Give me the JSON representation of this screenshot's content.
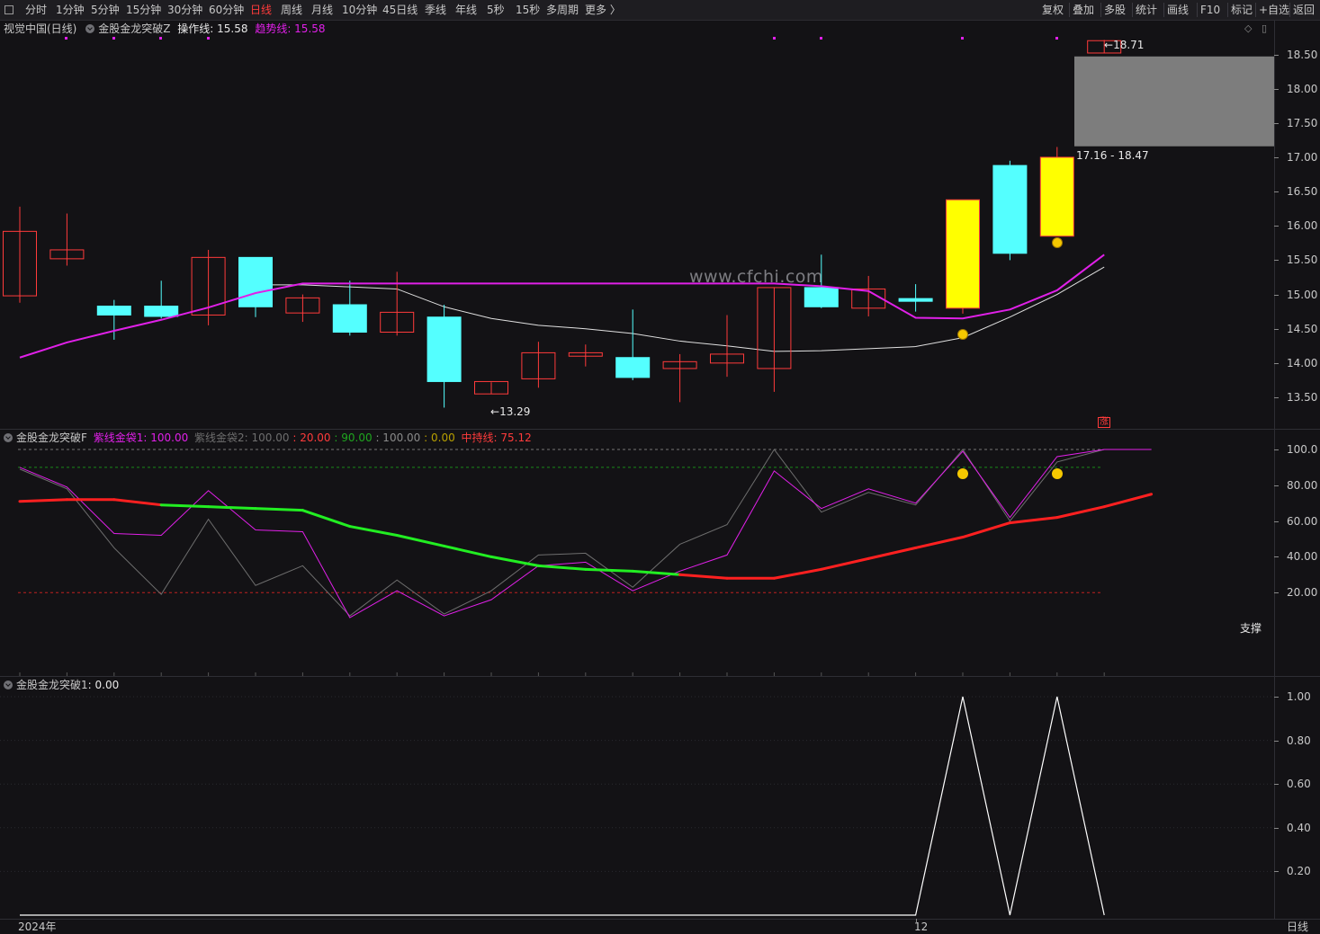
{
  "toolbar": {
    "periods": [
      "分时",
      "1分钟",
      "5分钟",
      "15分钟",
      "30分钟",
      "60分钟",
      "日线",
      "周线",
      "月线",
      "10分钟",
      "45日线",
      "季线",
      "年线",
      "5秒",
      "15秒",
      "多周期",
      "更多 〉"
    ],
    "active_period": "日线",
    "actions": [
      "复权",
      "叠加",
      "多股",
      "统计",
      "画线",
      "F10",
      "标记",
      "+自选",
      "返回"
    ]
  },
  "main_panel": {
    "stock_label": "视觉中国(日线)",
    "indicator_name": "金股金龙突破Z",
    "op_line_label": "操作线: 15.58",
    "trend_line_label": "趋势线: 15.58",
    "high_marker": "18.71",
    "low_marker": "13.29",
    "range_label": "17.16 - 18.47",
    "zhang_icon": "涨",
    "watermark": "www.cfchi.com",
    "y_ticks": [
      "18.50",
      "18.00",
      "17.50",
      "17.00",
      "16.50",
      "16.00",
      "15.50",
      "15.00",
      "14.50",
      "14.00",
      "13.50"
    ],
    "colors": {
      "up": "#ff3b3b",
      "down": "#54ffff",
      "signal": "#ffff00",
      "trend": "#e020e8",
      "ma": "#e0e0e0"
    }
  },
  "sub1": {
    "name": "金股金龙突破F",
    "v1_label": "紫线金袋1: 100.00",
    "v2_label": "紫线金袋2: 100.00",
    "v3_label": ": 20.00",
    "v4_label": ": 90.00",
    "v5_label": ": 100.00",
    "v6_label": ": 0.00",
    "hold_label": "中持线: 75.12",
    "support_label": "支撑",
    "y_ticks": [
      "100.0",
      "80.00",
      "60.00",
      "40.00",
      "20.00"
    ]
  },
  "sub2": {
    "name": "金股金龙突破1",
    "value_label": ": 0.00",
    "y_ticks": [
      "1.00",
      "0.80",
      "0.60",
      "0.40",
      "0.20"
    ]
  },
  "x_axis": {
    "labels": [
      "2024年",
      "12"
    ],
    "period_label": "日线"
  },
  "chart_data": [
    {
      "type": "candlestick",
      "title": "视觉中国(日线)",
      "ylim": [
        13.1,
        18.8
      ],
      "candles": [
        {
          "o": 14.98,
          "h": 16.28,
          "l": 14.88,
          "c": 15.92
        },
        {
          "o": 15.52,
          "h": 16.18,
          "l": 15.42,
          "c": 15.65
        },
        {
          "o": 14.83,
          "h": 14.92,
          "l": 14.34,
          "c": 14.7
        },
        {
          "o": 14.83,
          "h": 15.2,
          "l": 14.65,
          "c": 14.68
        },
        {
          "o": 14.7,
          "h": 15.65,
          "l": 14.55,
          "c": 15.54
        },
        {
          "o": 15.54,
          "h": 15.54,
          "l": 14.67,
          "c": 14.82
        },
        {
          "o": 14.73,
          "h": 15.0,
          "l": 14.6,
          "c": 14.95
        },
        {
          "o": 14.85,
          "h": 15.2,
          "l": 14.4,
          "c": 14.45
        },
        {
          "o": 14.45,
          "h": 15.33,
          "l": 14.4,
          "c": 14.74
        },
        {
          "o": 14.67,
          "h": 14.85,
          "l": 13.35,
          "c": 13.73
        },
        {
          "o": 13.55,
          "h": 13.72,
          "l": 13.55,
          "c": 13.73
        },
        {
          "o": 13.77,
          "h": 14.31,
          "l": 13.64,
          "c": 14.15
        },
        {
          "o": 14.1,
          "h": 14.27,
          "l": 13.95,
          "c": 14.15
        },
        {
          "o": 14.08,
          "h": 14.78,
          "l": 13.75,
          "c": 13.79
        },
        {
          "o": 13.92,
          "h": 14.13,
          "l": 13.43,
          "c": 14.02
        },
        {
          "o": 14.0,
          "h": 14.7,
          "l": 13.8,
          "c": 14.13
        },
        {
          "o": 13.92,
          "h": 15.1,
          "l": 13.58,
          "c": 15.1
        },
        {
          "o": 15.1,
          "h": 15.58,
          "l": 14.8,
          "c": 14.82
        },
        {
          "o": 14.8,
          "h": 15.27,
          "l": 14.68,
          "c": 15.08
        },
        {
          "o": 14.94,
          "h": 15.15,
          "l": 14.75,
          "c": 14.9
        },
        {
          "o": 14.8,
          "h": 16.38,
          "l": 14.72,
          "c": 16.38
        },
        {
          "o": 16.88,
          "h": 16.95,
          "l": 15.5,
          "c": 15.6
        },
        {
          "o": 15.85,
          "h": 17.15,
          "l": 15.85,
          "c": 17.0
        },
        {
          "o": 18.52,
          "h": 18.71,
          "l": 18.52,
          "c": 18.7
        }
      ],
      "ma_line": [
        null,
        null,
        null,
        null,
        null,
        15.14,
        15.14,
        15.11,
        15.08,
        14.82,
        14.65,
        14.55,
        14.5,
        14.43,
        14.32,
        14.25,
        14.17,
        14.18,
        14.21,
        14.24,
        14.37,
        14.67,
        15.0,
        15.4
      ],
      "trend_line": [
        14.08,
        14.3,
        14.47,
        14.63,
        14.81,
        15.02,
        15.16,
        15.16,
        15.16,
        15.16,
        15.16,
        15.16,
        15.16,
        15.16,
        15.16,
        15.16,
        15.16,
        15.12,
        15.05,
        14.66,
        14.65,
        14.78,
        15.06,
        15.58
      ]
    },
    {
      "type": "line",
      "title": "金股金龙突破F",
      "ylim": [
        -1,
        105
      ],
      "series": [
        {
          "name": "中持线",
          "values": [
            71,
            72,
            72,
            69,
            68,
            67,
            66,
            57,
            52,
            46,
            40,
            35,
            33,
            32,
            30,
            28,
            28,
            33,
            39,
            45,
            51,
            59,
            62,
            68,
            75
          ]
        },
        {
          "name": "紫线金袋1",
          "values": [
            90,
            79,
            53,
            52,
            77,
            55,
            54,
            6,
            21,
            7,
            16,
            35,
            37,
            21,
            32,
            41,
            88,
            67,
            78,
            70,
            99,
            62,
            96,
            100,
            100
          ]
        },
        {
          "name": "紫线金袋2",
          "values": [
            89,
            78,
            45,
            19,
            61,
            24,
            35,
            7,
            27,
            8,
            21,
            41,
            42,
            23,
            47,
            58,
            100,
            65,
            76,
            69,
            100,
            60,
            93,
            100,
            100
          ]
        }
      ],
      "levels": [
        20,
        90,
        100
      ]
    },
    {
      "type": "line",
      "title": "金股金龙突破1",
      "ylim": [
        0,
        1.05
      ],
      "series": [
        {
          "name": "金股金龙突破1",
          "values": [
            0,
            0,
            0,
            0,
            0,
            0,
            0,
            0,
            0,
            0,
            0,
            0,
            0,
            0,
            0,
            0,
            0,
            0,
            0,
            0,
            1,
            0,
            1,
            0
          ]
        }
      ]
    }
  ]
}
